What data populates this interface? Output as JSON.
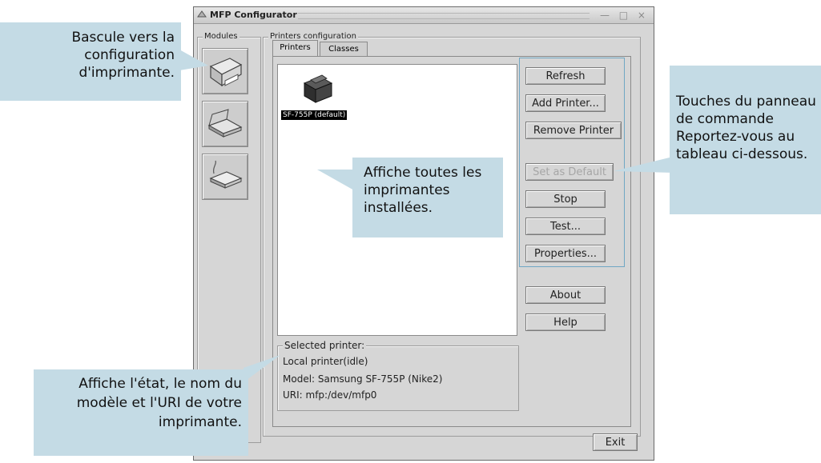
{
  "window": {
    "title": "MFP Configurator",
    "controls": "— □ ×"
  },
  "modules_label": "Modules",
  "printers_config_label": "Printers configuration",
  "tabs": [
    {
      "label": "Printers"
    },
    {
      "label": "Classes"
    }
  ],
  "printer_list": [
    {
      "name": "SF-755P (default)",
      "icon": "printer-icon"
    }
  ],
  "buttons": {
    "refresh": "Refresh",
    "add_printer": "Add Printer...",
    "remove_printer": "Remove Printer",
    "set_default": "Set as Default",
    "stop": "Stop",
    "test": "Test...",
    "properties": "Properties...",
    "about": "About",
    "help": "Help",
    "exit": "Exit"
  },
  "selected_printer": {
    "legend": "Selected printer:",
    "status": "Local printer(idle)",
    "model": "Model: Samsung SF-755P (Nike2)",
    "uri": "URI: mfp:/dev/mfp0"
  },
  "callouts": {
    "modules": "Bascule vers la configuration d'imprimante.",
    "printers": "Affiche toutes les imprimantes installées.",
    "controls": "Touches du panneau de commande Reportez-vous au tableau ci-dessous.",
    "status": "Affiche l'état, le nom du modèle et l'URI de votre imprimante."
  },
  "colors": {
    "callout_bg": "#c4dbe5",
    "window_bg": "#d6d6d6"
  }
}
